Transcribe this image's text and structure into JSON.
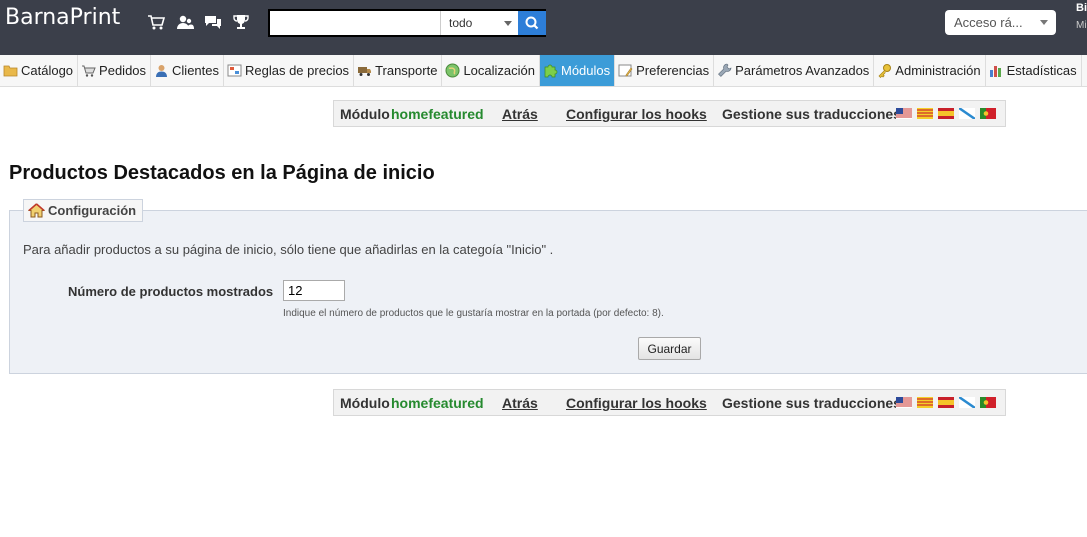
{
  "header": {
    "brand": "BarnaPrint",
    "icons": [
      "cart-icon",
      "customers-icon",
      "messages-icon",
      "trophy-icon"
    ],
    "search": {
      "value": "",
      "scope": "todo"
    },
    "quick_access": "Acceso rá...",
    "user_line1": "Bi",
    "user_line2": "Mi"
  },
  "tabs": [
    {
      "label": "Catálogo",
      "icon": "folder-icon"
    },
    {
      "label": "Pedidos",
      "icon": "cart-icon"
    },
    {
      "label": "Clientes",
      "icon": "user-icon"
    },
    {
      "label": "Reglas de precios",
      "icon": "price-rules-icon"
    },
    {
      "label": "Transporte",
      "icon": "truck-icon"
    },
    {
      "label": "Localización",
      "icon": "globe-icon"
    },
    {
      "label": "Módulos",
      "icon": "puzzle-icon",
      "active": true
    },
    {
      "label": "Preferencias",
      "icon": "preferences-icon"
    },
    {
      "label": "Parámetros Avanzados",
      "icon": "wrench-icon"
    },
    {
      "label": "Administración",
      "icon": "key-icon"
    },
    {
      "label": "Estadísticas",
      "icon": "stats-icon"
    }
  ],
  "module_toolbar": {
    "module_prefix": "Módulo",
    "module_name": "homefeatured",
    "back": "Atrás",
    "hooks": "Configurar los hooks",
    "translations": "Gestione sus traducciones",
    "flags": [
      "us-flag-icon",
      "catalan-flag-icon",
      "spain-flag-icon",
      "galician-flag-icon",
      "portugal-flag-icon"
    ]
  },
  "page": {
    "title": "Productos Destacados en la Página de inicio",
    "legend": "Configuración",
    "description": "Para añadir productos a su página de inicio, sólo tiene que añadirlas en la categoía \"Inicio\" .",
    "field_label": "Número de productos mostrados",
    "field_value": "12",
    "field_hint": "Indique el número de productos que le gustaría mostrar en la portada (por defecto: 8).",
    "save": "Guardar"
  },
  "colors": {
    "header_bg": "#3b3f4a",
    "active_tab": "#3c9cd8",
    "module_name": "#268a2f",
    "search_button": "#2d7ed8"
  }
}
